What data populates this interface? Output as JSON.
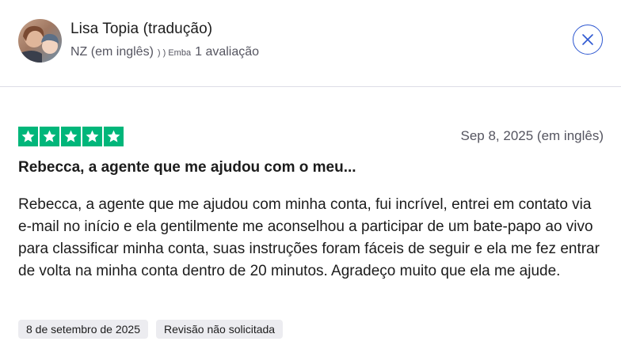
{
  "reviewer": {
    "name": "Lisa Topia (tradução)",
    "country": "NZ (em inglês)",
    "meta_extra": ") ) Emba",
    "review_count": "1 avaliação"
  },
  "close": {
    "icon": "close-icon"
  },
  "review": {
    "rating": 5,
    "rating_max": 5,
    "date": "Sep 8, 2025 (em inglês)",
    "title": "Rebecca, a agente que me ajudou com o meu...",
    "body": "Rebecca, a agente que me ajudou com minha conta, fui incrível, entrei em contato via e-mail no início e ela gentilmente me aconselhou a participar de um bate-papo ao vivo para classificar minha conta, suas instruções foram fáceis de seguir e ela me fez entrar de volta na minha conta dentro de 20 minutos. Agradeço muito que ela me ajude."
  },
  "tags": [
    {
      "label": "8 de setembro de 2025"
    },
    {
      "label": "Revisão não solicitada"
    }
  ],
  "colors": {
    "star": "#00b67a",
    "close_border": "#2e58d1"
  }
}
